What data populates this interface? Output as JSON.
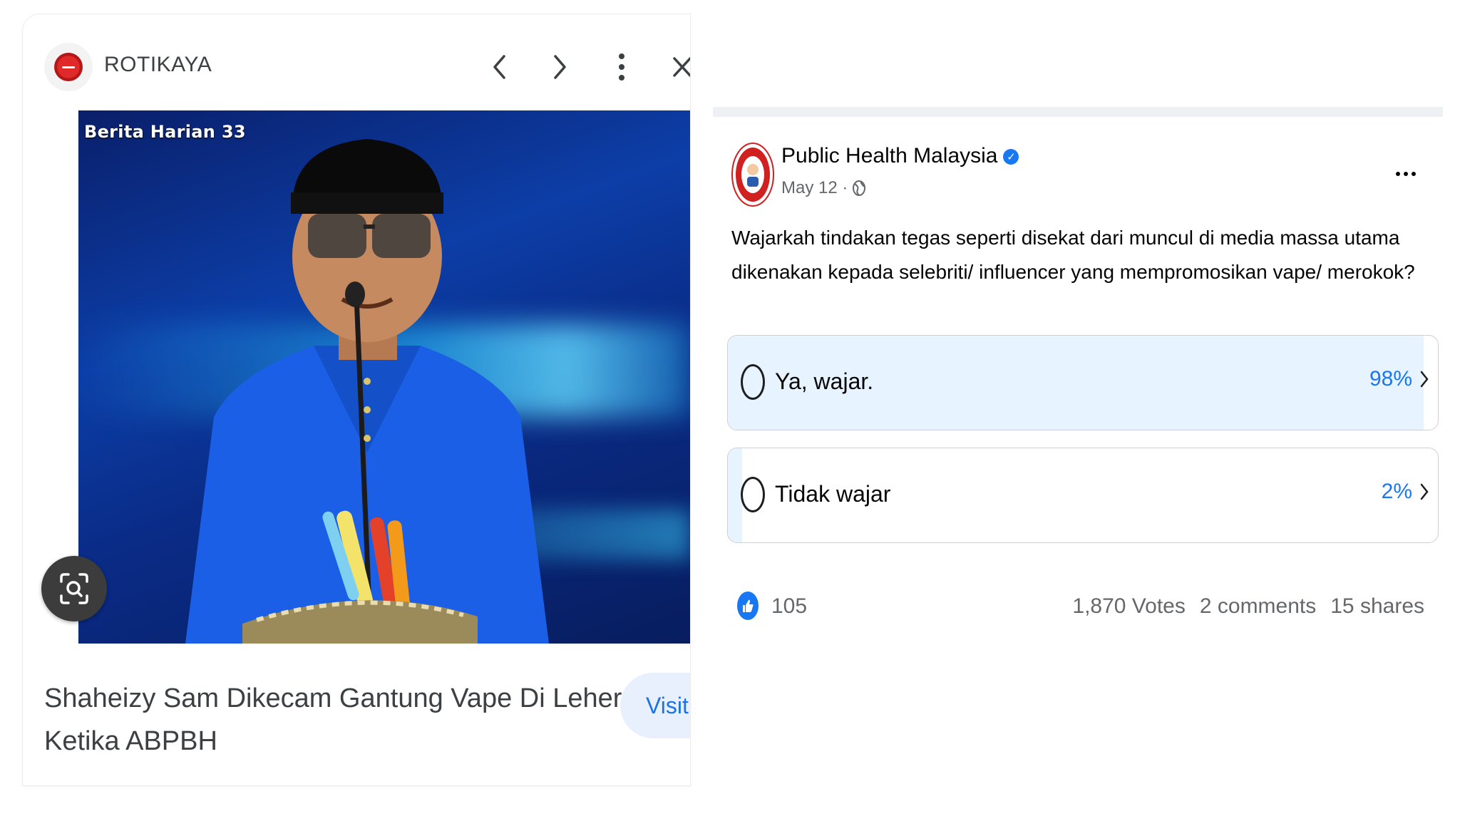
{
  "lens": {
    "site_name": "ROTIKAYA",
    "watermark": "Berita Harian 33",
    "title": "Shaheizy Sam Dikecam Gantung Vape Di Leher Ketika ABPBH",
    "visit_label": "Visit",
    "icons": [
      "site-logo",
      "chevron-left-icon",
      "chevron-right-icon",
      "more-vertical-icon",
      "close-icon",
      "lens-search-icon"
    ]
  },
  "fb": {
    "page_name": "Public Health Malaysia",
    "date": "May 12 ·",
    "question": "Wajarkah tindakan tegas seperti disekat dari muncul di media massa utama dikenakan kepada selebriti/ influencer yang mempromosikan vape/ merokok?",
    "options": [
      {
        "label": "Ya, wajar.",
        "percent": "98%",
        "share": 0.98
      },
      {
        "label": "Tidak wajar",
        "percent": "2%",
        "share": 0.02
      }
    ],
    "likes": "105",
    "votes": "1,870 Votes",
    "comments": "2 comments",
    "shares": "15 shares",
    "accent_color": "#1877f2",
    "fill_color": "#e7f3ff"
  }
}
